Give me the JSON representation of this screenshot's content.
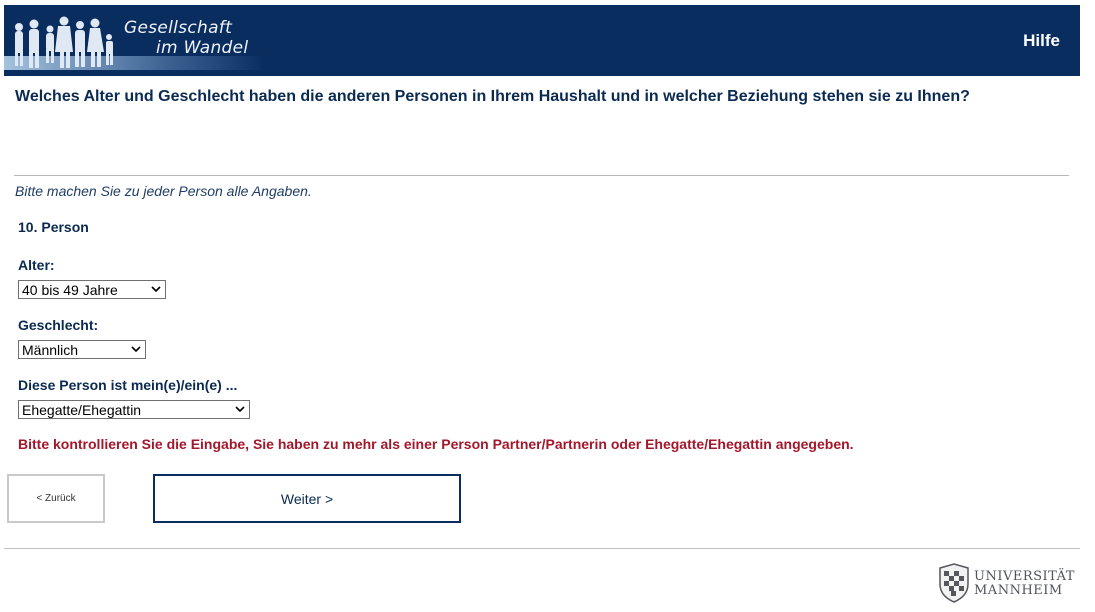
{
  "header": {
    "brand_line1": "Gesellschaft",
    "brand_line2": "im Wandel",
    "help_label": "Hilfe",
    "background_color": "#0a2d5f"
  },
  "question": "Welches Alter und Geschlecht haben die anderen Personen in Ihrem Haushalt und in welcher Beziehung stehen sie zu Ihnen?",
  "instruction": "Bitte machen Sie zu jeder Person alle Angaben.",
  "person": {
    "title": "10. Person",
    "age": {
      "label": "Alter:",
      "selected": "40 bis 49 Jahre"
    },
    "gender": {
      "label": "Geschlecht:",
      "selected": "Männlich"
    },
    "relation": {
      "label": "Diese Person ist mein(e)/ein(e) ...",
      "selected": "Ehegatte/Ehegattin"
    }
  },
  "error_message": "Bitte kontrollieren Sie die Eingabe, Sie haben zu mehr als einer Person Partner/Partnerin oder Ehegatte/Ehegattin angegeben.",
  "error_color": "#a3172b",
  "nav": {
    "back_label": "< Zurück",
    "next_label": "Weiter >"
  },
  "footer": {
    "uni_line1": "UNIVERSITÄT",
    "uni_line2": "MANNHEIM"
  }
}
